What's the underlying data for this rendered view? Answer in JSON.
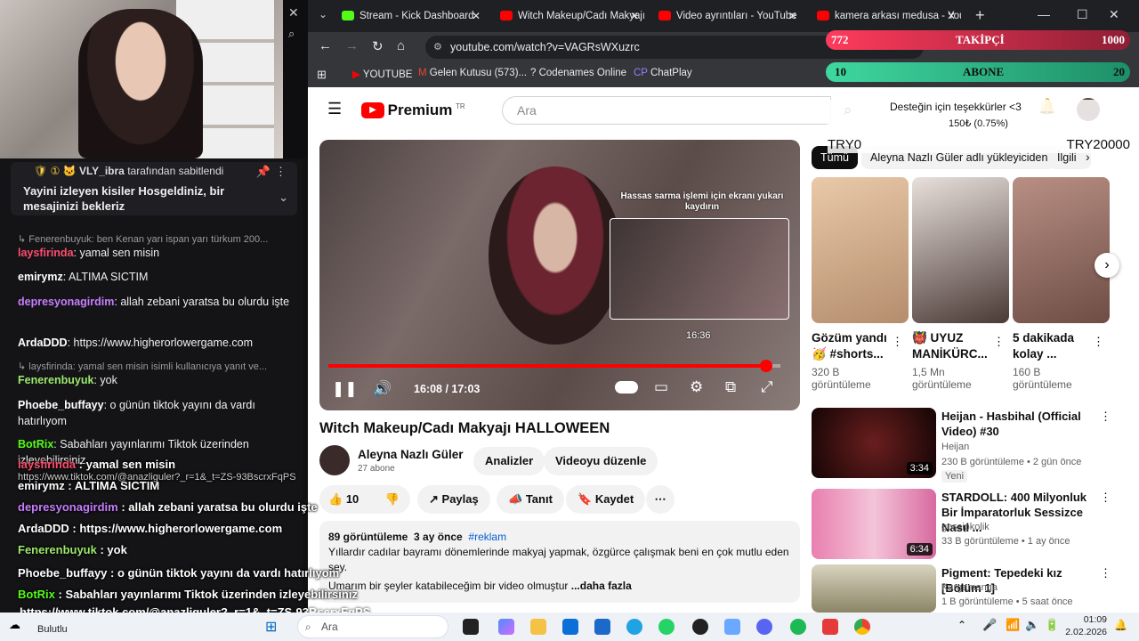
{
  "stream": {
    "pin_header_user": "VLY_ibra",
    "pin_header_suffix": "tarafından sabitlendi",
    "pin_message": "Yayini izleyen kisiler Hosgeldiniz, bir mesajinizi bekleriz",
    "chat": [
      {
        "reply": "Fenerenbuyuk: ben Kenan yarı ispan yarı türkum 200..."
      },
      {
        "user": "laysfirinda",
        "color": "#ff4d6d",
        "msg": "yamal sen misin"
      },
      {
        "user": "emirymz",
        "color": "#ffffff",
        "msg": "ALTIMA SICTIM"
      },
      {
        "user": "depresyonagirdim",
        "color": "#c77dff",
        "msg": "allah zebani yaratsa bu olurdu işte"
      },
      {
        "user": "ArdaDDD",
        "color": "#ffffff",
        "msg": "https://www.higherorlowergame.com"
      },
      {
        "reply": "laysfirinda: yamal sen misin isimli kullanıcıya yanıt ve..."
      },
      {
        "user": "Fenerenbuyuk",
        "color": "#9de86b",
        "msg": "yok"
      },
      {
        "user": "Phoebe_buffayy",
        "color": "#ffffff",
        "msg": "o günün tiktok yayını da vardı hatırlıyom"
      },
      {
        "user": "BotRix",
        "color": "#53fc18",
        "msg": "Sabahları yayınlarımı Tiktok üzerinden izleyebilirsiniz"
      }
    ],
    "overlay_chat": [
      {
        "user": "laysfirinda",
        "color": "#ff4d6d",
        "msg": "yamal sen misin"
      },
      {
        "user": "emirymz",
        "color": "#ffffff",
        "msg": "ALTIMA SICTIM"
      },
      {
        "user": "depresyonagirdim",
        "color": "#c77dff",
        "msg": "allah zebani yaratsa bu olurdu işte"
      },
      {
        "user": "ArdaDDD",
        "color": "#ffffff",
        "msg": "https://www.higherorlowergame.com"
      },
      {
        "user": "Fenerenbuyuk",
        "color": "#9de86b",
        "msg": "yok"
      },
      {
        "user": "Phoebe_buffayy",
        "color": "#ffffff",
        "msg": "o günün tiktok yayını da vardı hatırlıyom"
      },
      {
        "user": "BotRix",
        "color": "#53fc18",
        "msg": "Sabahları yayınlarımı Tiktok üzerinden izleyebilirsiniz"
      }
    ],
    "overlay_link": "https://www.tiktok.com/@anazliguler?_r=1&_t=ZS-93BscrxFqPS",
    "overlay_link_small": "https://www.tiktok.com/@anazliguler?_r=1&_t=ZS-93BscrxFqPS",
    "goal_followers": {
      "current": "772",
      "label": "TAKİPÇİ",
      "target": "1000"
    },
    "goal_subs": {
      "current": "10",
      "label": "ABONE",
      "target": "20"
    },
    "tip_text": "Desteğin için teşekkürler <3",
    "tip_amount": "150₺ (0.75%)",
    "tip_min": "TRY0",
    "tip_max": "TRY20000"
  },
  "browser": {
    "tabs": [
      {
        "label": "Stream - Kick Dashboard",
        "color": "#53fc18"
      },
      {
        "label": "Witch Makeup/Cadı Makyajı",
        "color": "#ff0000"
      },
      {
        "label": "Video ayrıntıları - YouTube",
        "color": "#ff0000"
      },
      {
        "label": "kamera arkası medusa - YouTube",
        "color": "#ff0000"
      }
    ],
    "url": "youtube.com/watch?v=VAGRsWXuzrc",
    "bookmarks": [
      "YOUTUBE",
      "Gelen Kutusu (573)...",
      "Codenames Online",
      "ChatPlay"
    ]
  },
  "youtube": {
    "logo": "Premium",
    "logo_sup": "TR",
    "search_placeholder": "Ara",
    "scrub_hint": "Hassas sarma işlemi için ekranı yukarı kaydırın",
    "preview_time": "16:36",
    "time_current": "16:08",
    "time_total": "17:03",
    "progress": 0.968,
    "title": "Witch Makeup/Cadı Makyajı HALLOWEEN",
    "channel": "Aleyna Nazlı Güler",
    "subs": "27 abone",
    "btn_analytics": "Analizler",
    "btn_edit": "Videoyu düzenle",
    "likes": "10",
    "btn_share": "Paylaş",
    "btn_promote": "Tanıt",
    "btn_save": "Kaydet",
    "desc_views": "89 görüntüleme",
    "desc_date": "3 ay önce",
    "desc_tag": "#reklam",
    "desc_line1": "Yıllardır cadılar bayramı dönemlerinde makyaj yapmak, özgürce çalışmak beni en çok mutlu eden şey.",
    "desc_line2": "Umarım bir şeyler katabileceğim bir video olmuştur",
    "desc_more": "...daha fazla",
    "chips": [
      "Tümü",
      "Aleyna Nazlı Güler adlı yükleyiciden",
      "İlgili"
    ],
    "shorts": [
      {
        "title": "Gözüm yandı 🥳 #shorts...",
        "views": "320 B görüntüleme"
      },
      {
        "title": "👹 UYUZ MANİKÜRC...",
        "views": "1,5 Mn görüntüleme"
      },
      {
        "title": "5 dakikada kolay ...",
        "views": "160 B görüntüleme"
      }
    ],
    "videos": [
      {
        "title": "Heijan - Hasbihal (Official Video) #30",
        "channel": "Heijan",
        "meta": "230 B görüntüleme • 2 gün önce",
        "badge": "Yeni",
        "duration": "3:34"
      },
      {
        "title": "STARDOLL: 400 Milyonluk Bir İmparatorluk Sessizce Nasıl ...",
        "channel": "gossipkolik",
        "meta": "33 B görüntüleme • 1 ay önce",
        "duration": "6:34"
      },
      {
        "title": "Pigment: Tepedeki kız [Bölüm 1]",
        "channel": "Kargamanga",
        "meta": "1 B görüntüleme • 5 saat önce",
        "duration": ""
      }
    ]
  },
  "taskbar": {
    "weather": "Bulutlu",
    "search": "Ara",
    "time": "01:09",
    "date": "2.02.2026"
  }
}
